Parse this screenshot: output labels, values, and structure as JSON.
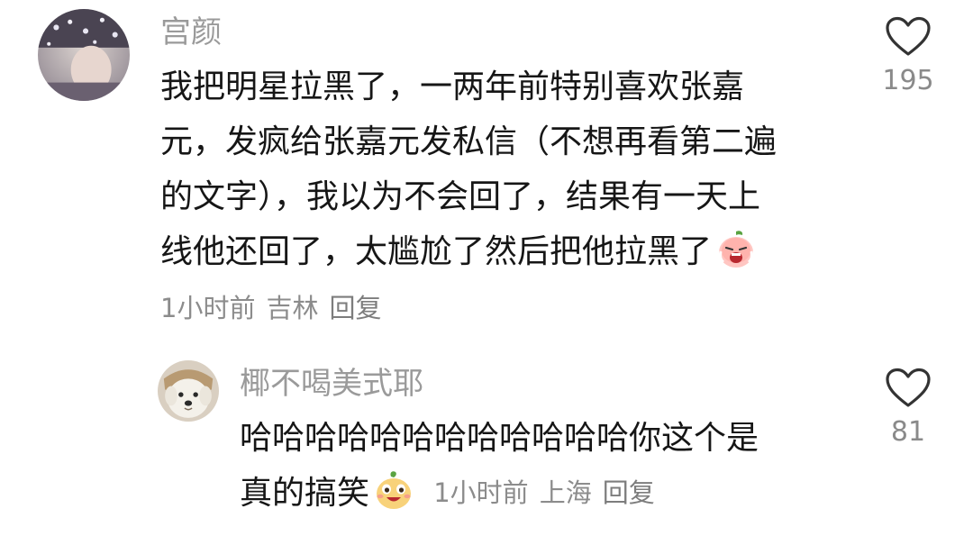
{
  "comment": {
    "username": "宫颜",
    "text_lines": [
      "我把明星拉黑了，一两年前特别喜欢张嘉",
      "元，发疯给张嘉元发私信（不想再看第二遍",
      "的文字），我以为不会回了，结果有一天上",
      "线他还回了，太尴尬了然后把他拉黑了"
    ],
    "time": "1小时前",
    "location": "吉林",
    "reply_label": "回复",
    "like_count": "195",
    "emoji": "crying-peach-emoji"
  },
  "reply": {
    "username": "椰不喝美式耶",
    "text_lines": [
      "哈哈哈哈哈哈哈哈哈哈哈哈你这个是",
      "真的搞笑"
    ],
    "time": "1小时前",
    "location": "上海",
    "reply_label": "回复",
    "like_count": "81",
    "emoji": "laughing-sprout-emoji"
  },
  "colors": {
    "username": "#9a9a9a",
    "text": "#161616",
    "meta": "#8c8c8c",
    "heart_stroke": "#333333"
  }
}
